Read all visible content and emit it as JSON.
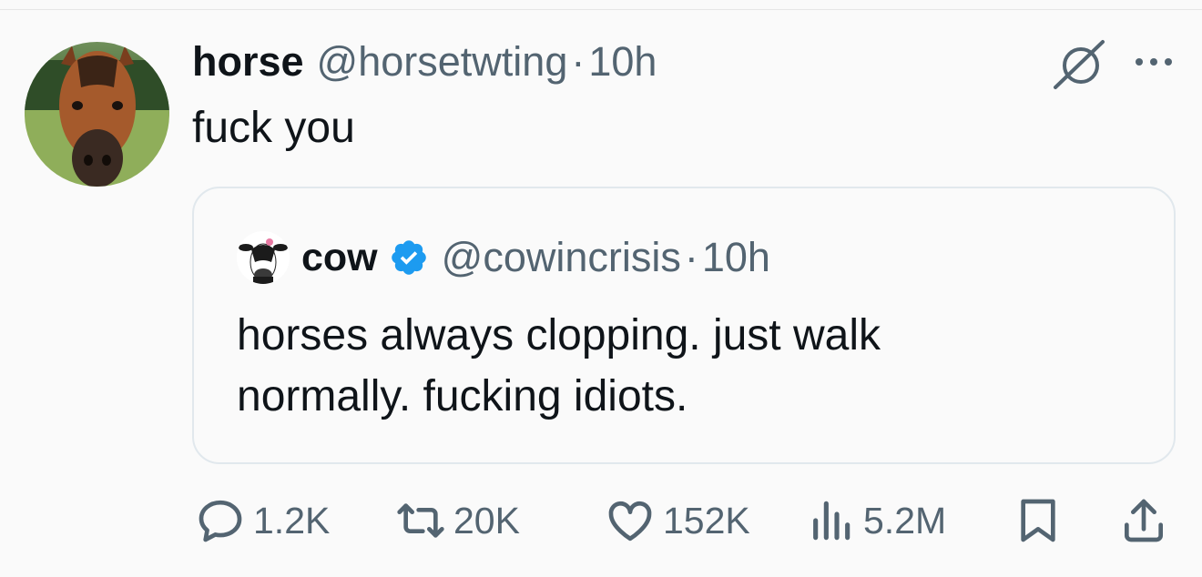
{
  "tweet": {
    "author": {
      "name": "horse",
      "handle": "@horsetwting",
      "dot": "·",
      "time": "10h"
    },
    "text": "fuck you"
  },
  "quote": {
    "author": {
      "name": "cow",
      "handle": "@cowincrisis",
      "dot": "·",
      "time": "10h",
      "verified": true
    },
    "lines": [
      "horses always clopping. just walk",
      "normally. fucking idiots."
    ]
  },
  "actions": {
    "replies": "1.2K",
    "reposts": "20K",
    "likes": "152K",
    "views": "5.2M"
  },
  "icons": [
    "grok-icon",
    "more-icon",
    "reply-icon",
    "repost-icon",
    "like-icon",
    "views-icon",
    "bookmark-icon",
    "share-icon",
    "verified-icon"
  ],
  "colors": {
    "verified": "#1d9bf0",
    "secondary_text": "#536471",
    "text": "#0f1419"
  }
}
